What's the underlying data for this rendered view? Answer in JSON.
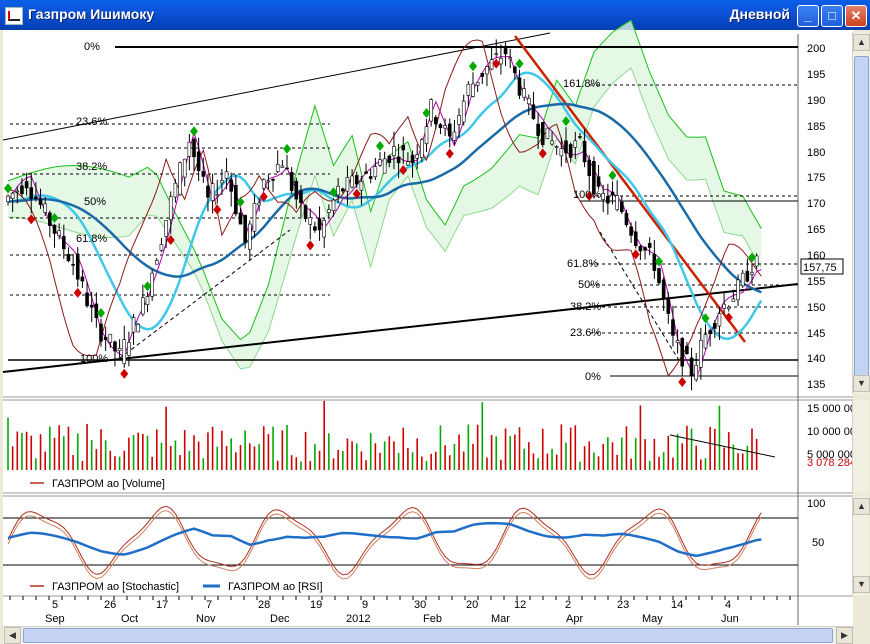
{
  "window": {
    "title": "Газпром Ишимоку",
    "period": "Дневной"
  },
  "buttons": {
    "minimize": "_",
    "maximize": "□",
    "close": "✕"
  },
  "price_axis": {
    "ticks": [
      "200",
      "195",
      "190",
      "185",
      "180",
      "175",
      "170",
      "165",
      "160",
      "155",
      "150",
      "145",
      "140",
      "135"
    ],
    "last": "157,75"
  },
  "fib_upper": [
    "0%",
    "23.6%",
    "38.2%",
    "50%",
    "61.8%",
    "100%"
  ],
  "fib_lower": [
    "161.8%",
    "100%",
    "61.8%",
    "50%",
    "38.2%",
    "23.6%",
    "0%"
  ],
  "volume_axis": {
    "ticks": [
      "15 000 000",
      "10 000 000",
      "5 000 000"
    ],
    "last": "3 078 284"
  },
  "volume_legend": "ГАЗПРОМ ао [Volume]",
  "osc_axis": {
    "ticks": [
      "100",
      "50"
    ]
  },
  "osc_legend": {
    "stochastic": "ГАЗПРОМ ао [Stochastic]",
    "rsi": "ГАЗПРОМ ао [RSI]"
  },
  "date_axis": {
    "days": [
      "5",
      "26",
      "17",
      "7",
      "28",
      "19",
      "9",
      "30",
      "20",
      "12",
      "2",
      "23",
      "14",
      "4"
    ],
    "months": [
      "Sep",
      "Oct",
      "Nov",
      "Dec",
      "2012",
      "Feb",
      "Mar",
      "Apr",
      "May",
      "Jun"
    ]
  },
  "colors": {
    "up": "#00aa00",
    "down": "#cc0000",
    "kijun": "#1a6aa8",
    "tenkan": "#40c8e8",
    "cloud": "#16c016",
    "rsi": "#1f6fc8",
    "stoch": "#b03020"
  }
}
